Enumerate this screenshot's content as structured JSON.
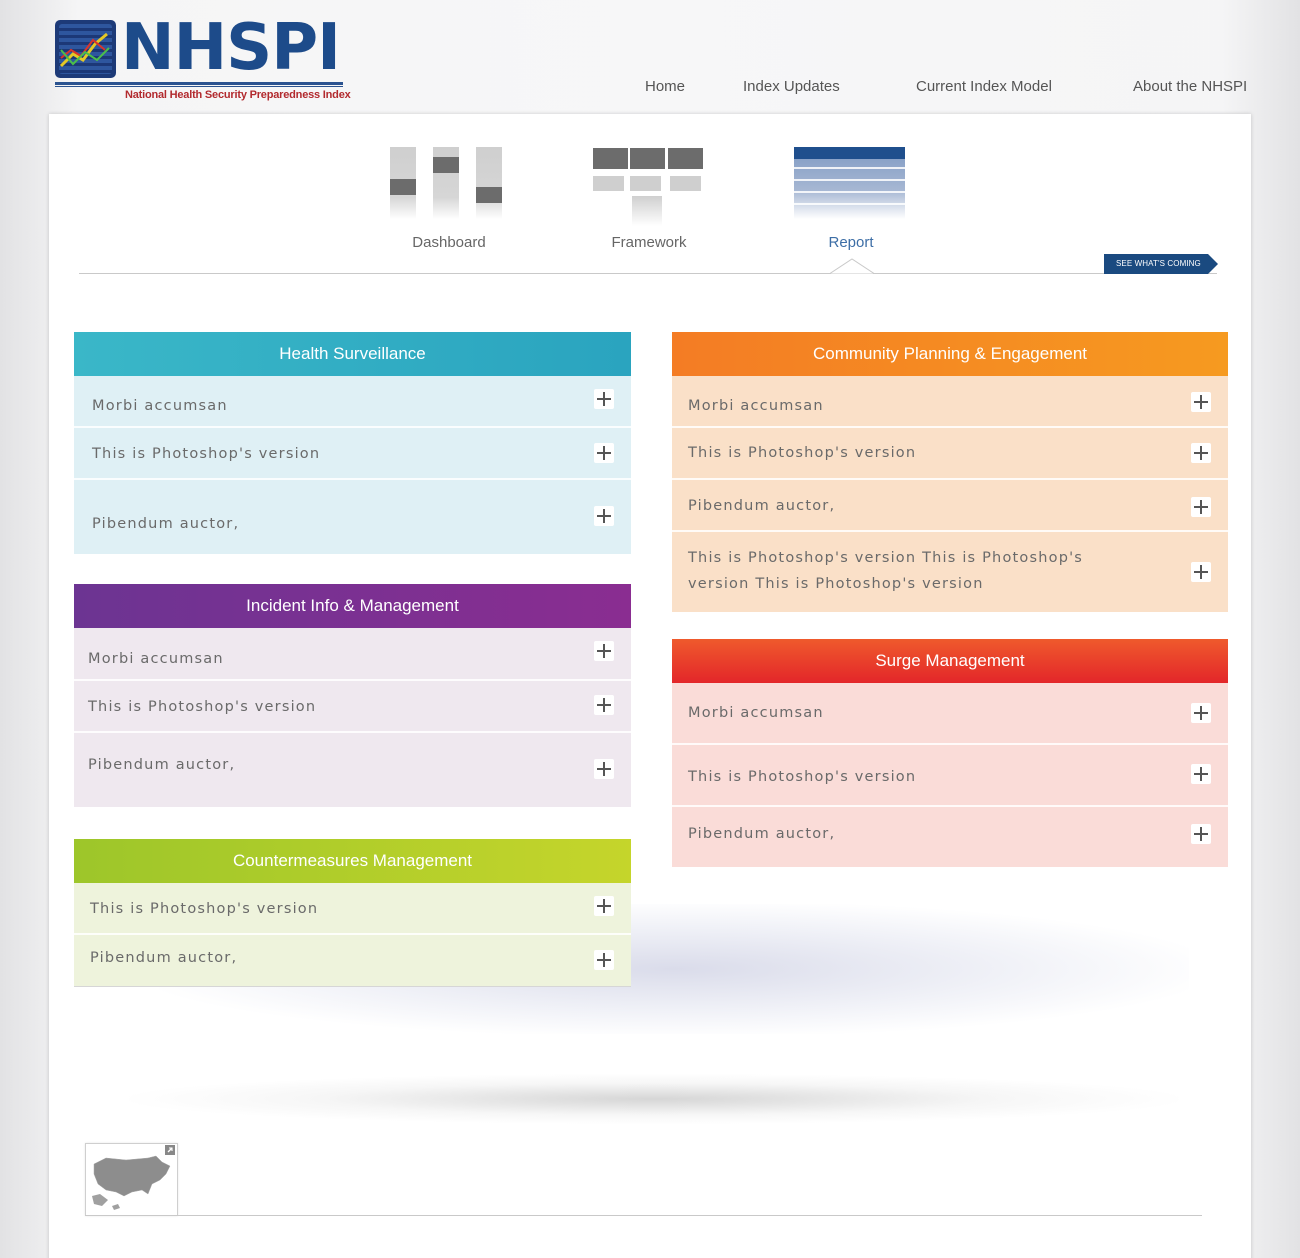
{
  "brand": {
    "name": "NHSPI",
    "tagline": "National Health Security Preparedness Index"
  },
  "nav": [
    {
      "label": "Home"
    },
    {
      "label": "Index Updates"
    },
    {
      "label": "Current Index Model"
    },
    {
      "label": "About the NHSPI"
    }
  ],
  "views": {
    "dashboard": "Dashboard",
    "framework": "Framework",
    "report": "Report",
    "active": "Report"
  },
  "see_whats_coming": "SEE WHAT'S COMING",
  "panels": {
    "health_surveillance": {
      "title": "Health Surveillance",
      "color": "#35b0c6",
      "items": [
        "Morbi accumsan",
        "This is Photoshop's version",
        "Pibendum auctor,"
      ]
    },
    "incident_info": {
      "title": "Incident Info & Management",
      "color": "#7a3192",
      "items": [
        "Morbi accumsan",
        "This is Photoshop's version",
        "Pibendum auctor,"
      ]
    },
    "countermeasures": {
      "title": "Countermeasures Management",
      "color": "#b3cd2a",
      "items": [
        "This is Photoshop's version",
        "Pibendum auctor,"
      ]
    },
    "community": {
      "title": "Community Planning & Engagement",
      "color": "#f58a22",
      "items": [
        "Morbi accumsan",
        "This is Photoshop's version",
        "Pibendum auctor,",
        "This is Photoshop's version This is Photoshop's version This is Photoshop's version"
      ]
    },
    "surge": {
      "title": "Surge Management",
      "color": "#e8352a",
      "items": [
        "Morbi accumsan",
        "This is Photoshop's version",
        "Pibendum auctor,"
      ]
    }
  },
  "icons": {
    "expand": "plus-icon",
    "map": "us-map-icon"
  }
}
